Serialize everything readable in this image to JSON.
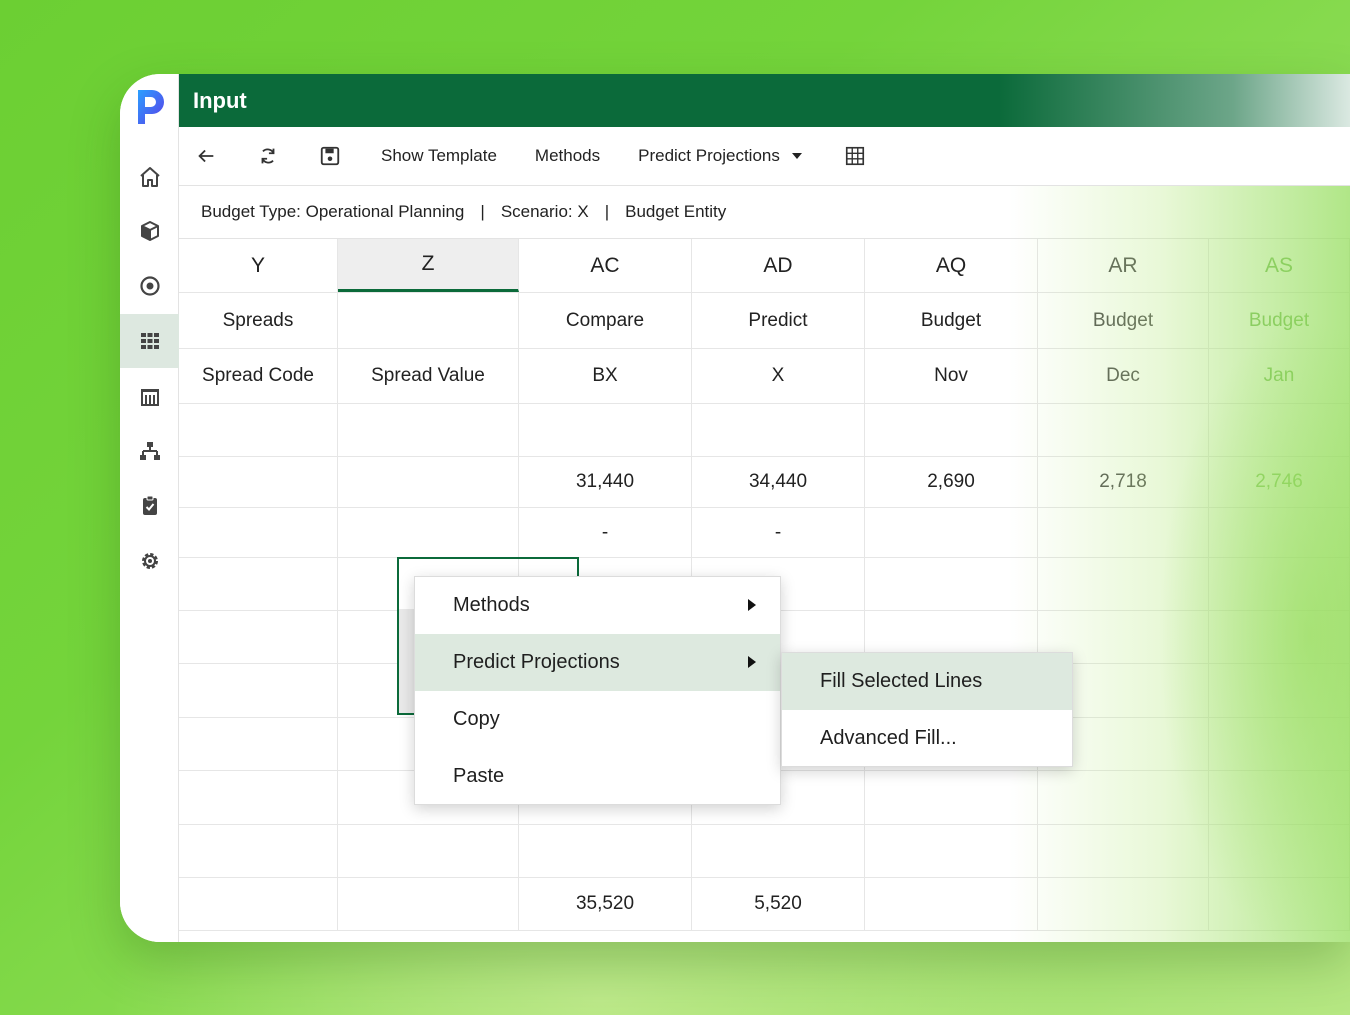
{
  "window": {
    "title": "Input"
  },
  "toolbar": {
    "back_icon": "arrow-left-icon",
    "refresh_icon": "refresh-icon",
    "save_icon": "save-icon",
    "show_template": "Show Template",
    "methods": "Methods",
    "predict_projections": "Predict Projections",
    "grid_icon": "grid-icon"
  },
  "info": {
    "budget_type": "Budget Type: Operational Planning",
    "sep1": "|",
    "scenario": "Scenario: X",
    "sep2": "|",
    "entity": "Budget Entity"
  },
  "grid": {
    "columns": [
      "Y",
      "Z",
      "AC",
      "AD",
      "AQ",
      "AR",
      "AS"
    ],
    "row1": [
      "Spreads",
      "",
      "Compare",
      "Predict",
      "Budget",
      "Budget",
      "Budget"
    ],
    "row2": [
      "Spread Code",
      "Spread Value",
      "BX",
      "X",
      "Nov",
      "Dec",
      "Jan"
    ],
    "data": [
      [
        "",
        "",
        "",
        "",
        "",
        "",
        ""
      ],
      [
        "",
        "",
        "31,440",
        "34,440",
        "2,690",
        "2,718",
        "2,746"
      ],
      [
        "",
        "",
        "-",
        "-",
        "",
        "",
        ""
      ],
      [
        "",
        "",
        "",
        "",
        "",
        "",
        ""
      ],
      [
        "",
        "",
        "",
        "",
        "",
        "",
        ""
      ],
      [
        "",
        "",
        "",
        "",
        "",
        "",
        ""
      ],
      [
        "",
        "",
        "",
        "",
        "",
        "",
        ""
      ],
      [
        "",
        "",
        "",
        "",
        "",
        "",
        ""
      ],
      [
        "",
        "",
        "",
        "",
        "",
        "",
        ""
      ],
      [
        "",
        "",
        "35,520",
        "5,520",
        "",
        "",
        ""
      ]
    ]
  },
  "context_menu": {
    "items": [
      "Methods",
      "Predict Projections",
      "Copy",
      "Paste"
    ]
  },
  "submenu": {
    "items": [
      "Fill Selected Lines",
      "Advanced Fill..."
    ]
  },
  "colors": {
    "brand": "#0b6a3a",
    "highlight": "#dde9df"
  }
}
